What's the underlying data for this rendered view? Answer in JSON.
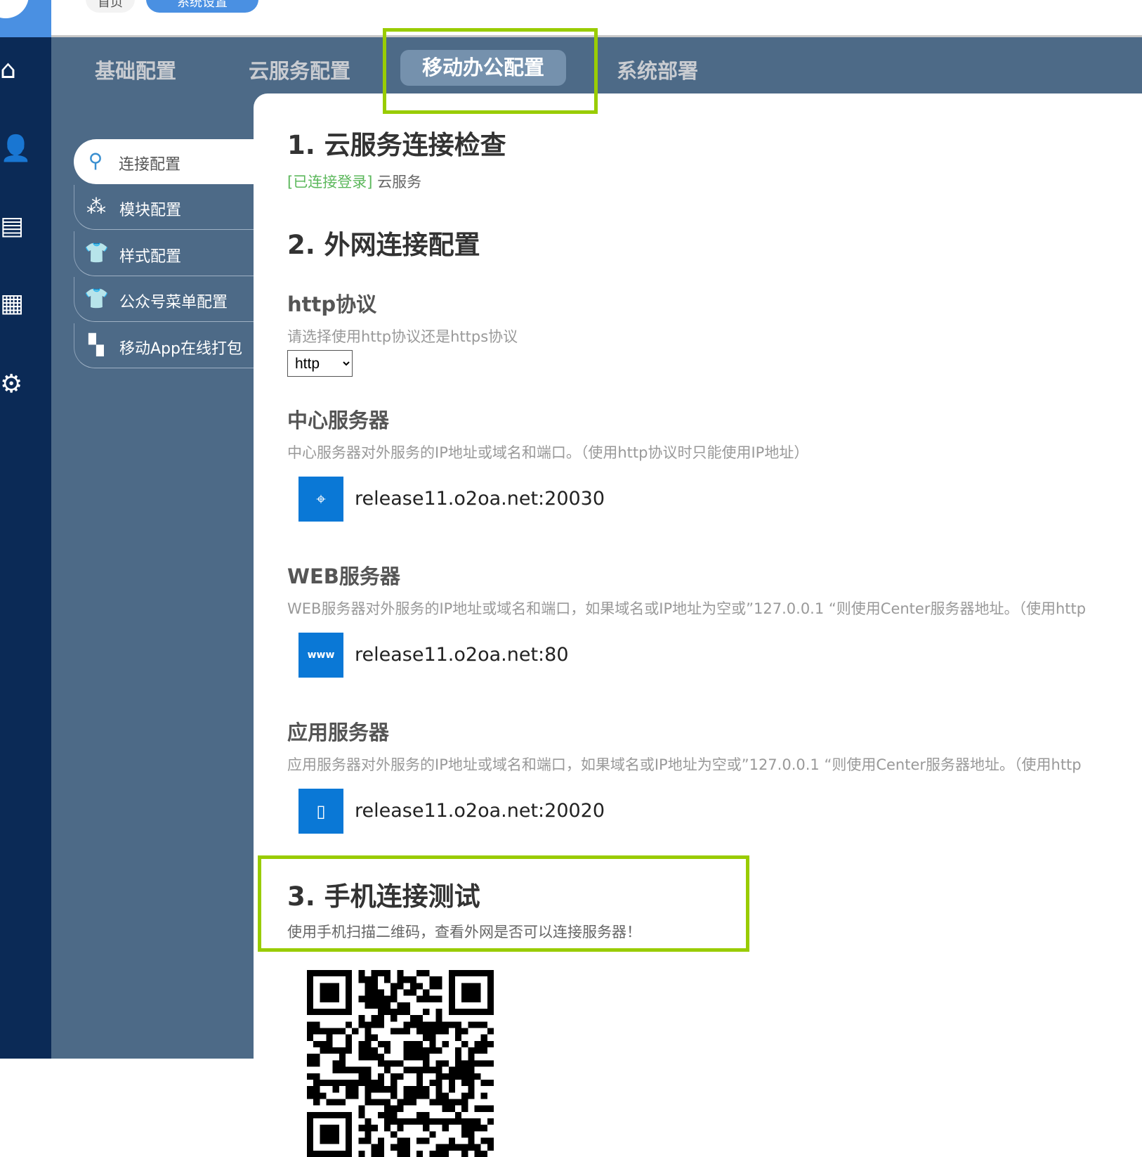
{
  "top_tabs": [
    "首页",
    "系统设置"
  ],
  "main_tabs": [
    {
      "label": "基础配置"
    },
    {
      "label": "云服务配置"
    },
    {
      "label": "移动办公配置",
      "active": true
    },
    {
      "label": "系统部署"
    }
  ],
  "submenu": [
    {
      "label": "连接配置",
      "icon": "plug-icon",
      "active": true
    },
    {
      "label": "模块配置",
      "icon": "modules-icon"
    },
    {
      "label": "样式配置",
      "icon": "shirt-icon"
    },
    {
      "label": "公众号菜单配置",
      "icon": "shirt-icon"
    },
    {
      "label": "移动App在线打包",
      "icon": "apps-icon"
    }
  ],
  "section1": {
    "title": "1. 云服务连接检查",
    "status": "[已连接登录]",
    "status_suffix": "云服务",
    "status_color": "#5cb85c"
  },
  "section2": {
    "title": "2. 外网连接配置",
    "http": {
      "title": "http协议",
      "desc": "请选择使用http协议还是https协议",
      "value": "http"
    },
    "center": {
      "title": "中心服务器",
      "desc": "中心服务器对外服务的IP地址或域名和端口。（使用http协议时只能使用IP地址）",
      "value": "release11.o2oa.net:20030"
    },
    "web": {
      "title": "WEB服务器",
      "desc": "WEB服务器对外服务的IP地址或域名和端口，如果域名或IP地址为空或”127.0.0.1 “则使用Center服务器地址。（使用http",
      "value": "release11.o2oa.net:80"
    },
    "app": {
      "title": "应用服务器",
      "desc": "应用服务器对外服务的IP地址或域名和端口，如果域名或IP地址为空或”127.0.0.1 “则使用Center服务器地址。（使用http",
      "value": "release11.o2oa.net:20020"
    }
  },
  "section3": {
    "title": "3. 手机连接测试",
    "desc": "使用手机扫描二维码，查看外网是否可以连接服务器！"
  },
  "colors": {
    "accent": "#4a90e2",
    "highlight": "#99cc00",
    "nav": "#0b2a56",
    "band": "#4d6a87"
  }
}
